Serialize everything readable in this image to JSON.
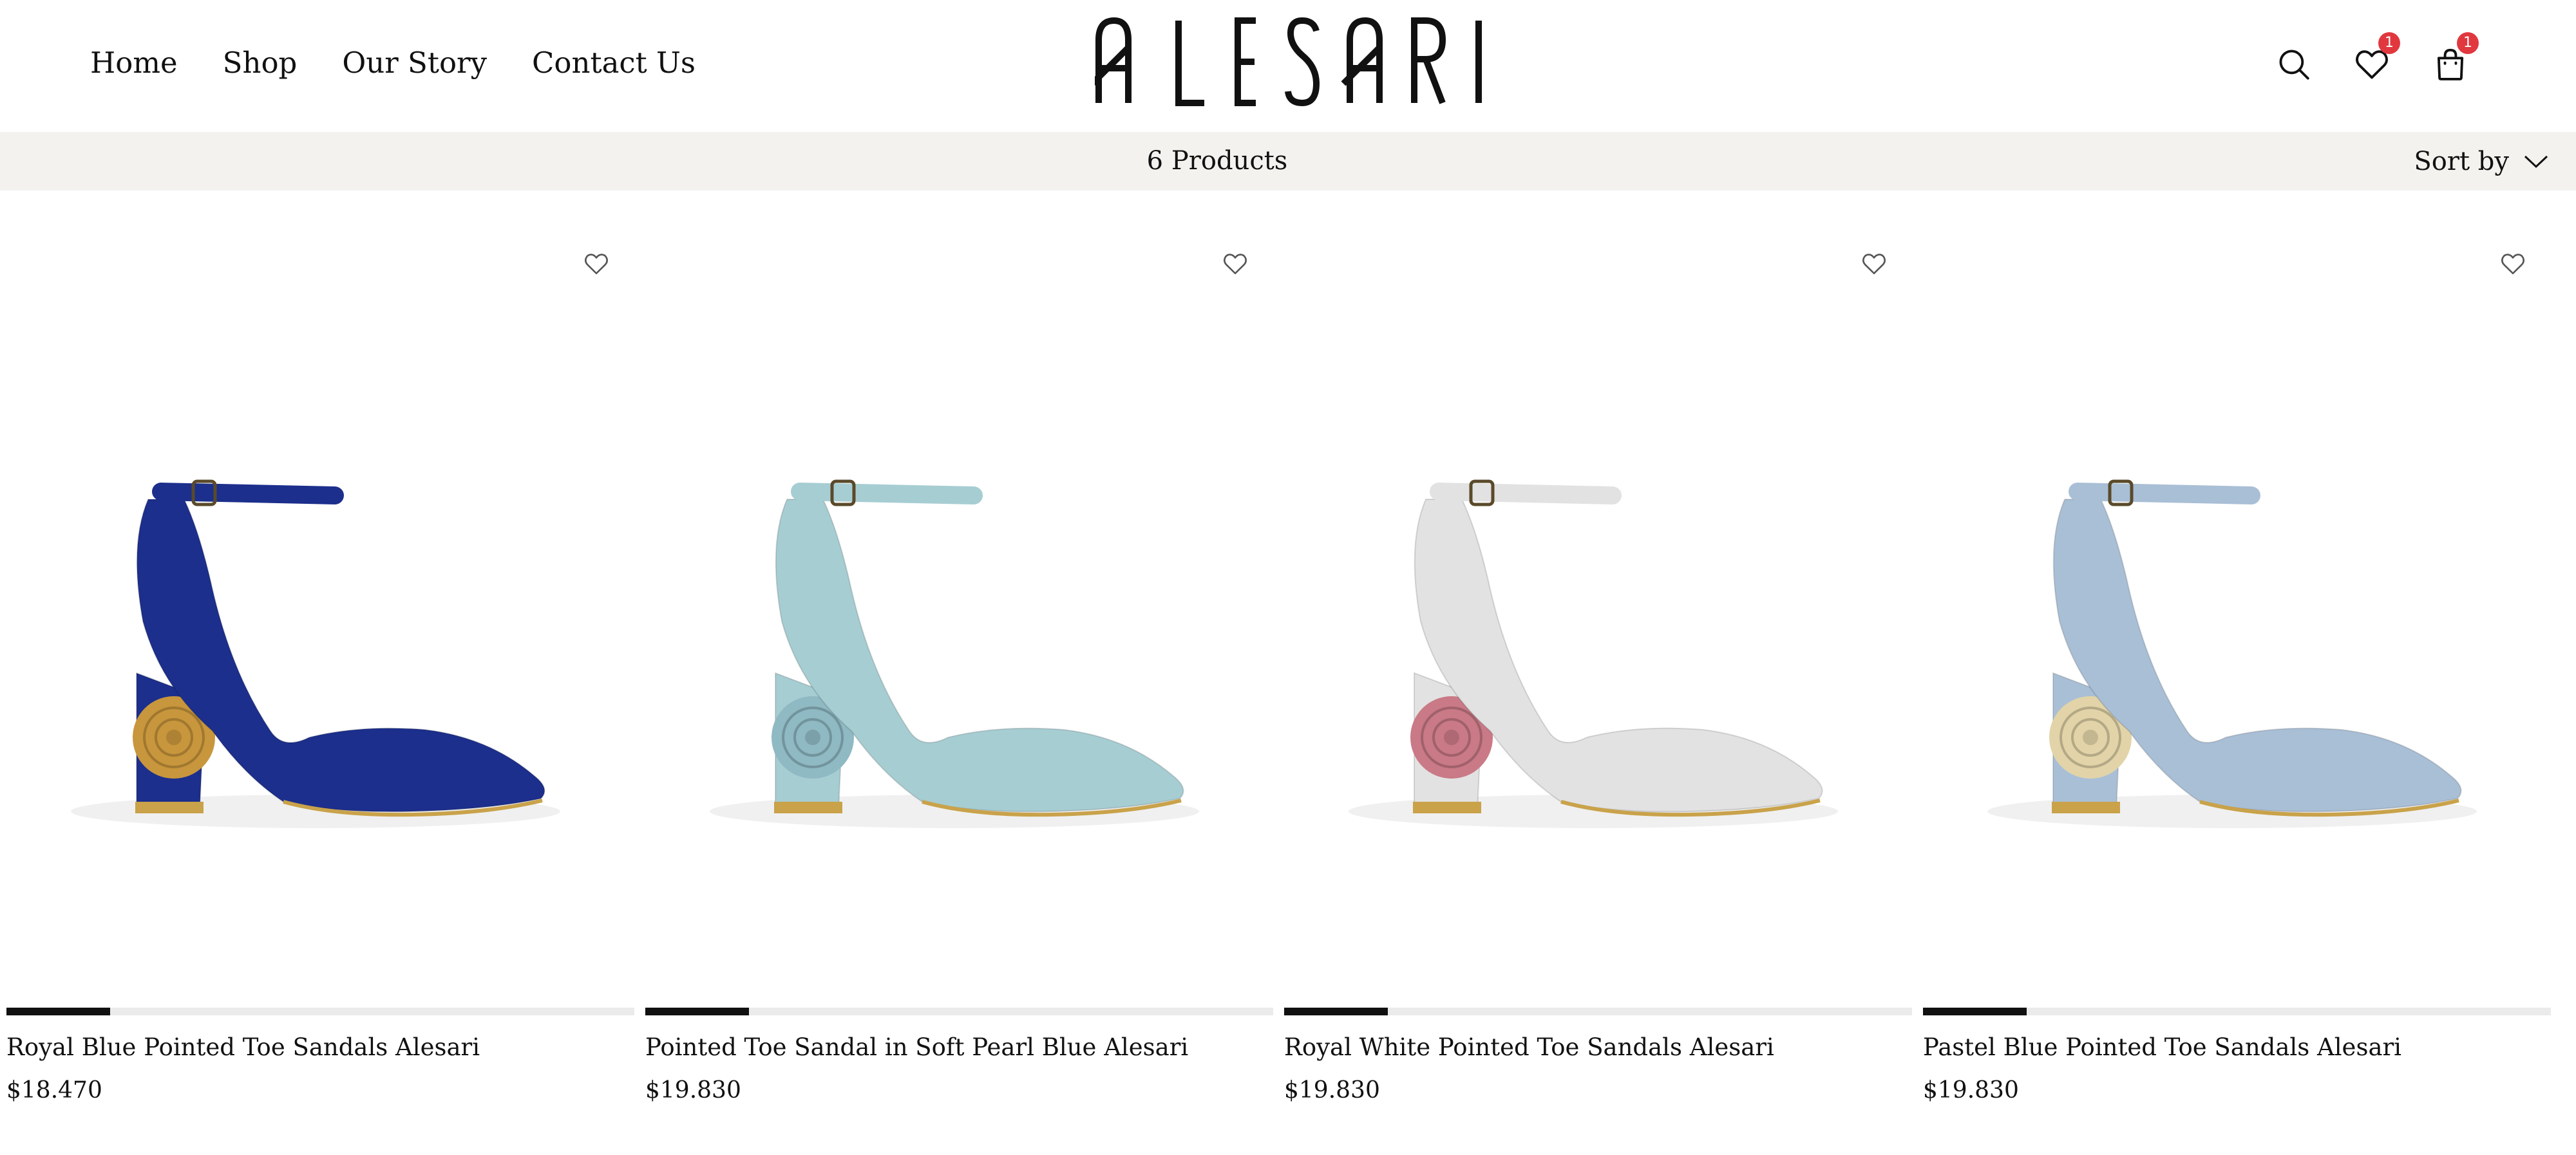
{
  "header": {
    "nav": [
      "Home",
      "Shop",
      "Our Story",
      "Contact Us"
    ],
    "brand": "ALESARI",
    "icons": {
      "search": "search-icon",
      "wishlist": "heart-icon",
      "cart": "shopping-bag-icon"
    },
    "wishlist_count": "1",
    "cart_count": "1"
  },
  "toolbar": {
    "product_count": "6 Products",
    "sort_label": "Sort by",
    "sort_icon": "chevron-down-icon"
  },
  "colors": {
    "toolbar_bg": "#f3f2ef",
    "badge": "#e0383e",
    "progress_fill": "#111111",
    "progress_track": "#ebebeb"
  },
  "products": [
    {
      "name": "Royal Blue Pointed Toe Sandals Alesari",
      "price": "$18.470",
      "image_progress": 0.165,
      "shoe_color": "#1c2f8c",
      "flower_color": "#c8963c"
    },
    {
      "name": "Pointed Toe Sandal in Soft Pearl Blue Alesari",
      "price": "$19.830",
      "image_progress": 0.165,
      "shoe_color": "#a6cdd2",
      "flower_color": "#8fb9c3"
    },
    {
      "name": "Royal White Pointed Toe Sandals Alesari",
      "price": "$19.830",
      "image_progress": 0.165,
      "shoe_color": "#e2e2e2",
      "flower_color": "#c97a86"
    },
    {
      "name": "Pastel Blue Pointed Toe Sandals Alesari",
      "price": "$19.830",
      "image_progress": 0.165,
      "shoe_color": "#a9bfd6",
      "flower_color": "#e2d4a8"
    }
  ]
}
